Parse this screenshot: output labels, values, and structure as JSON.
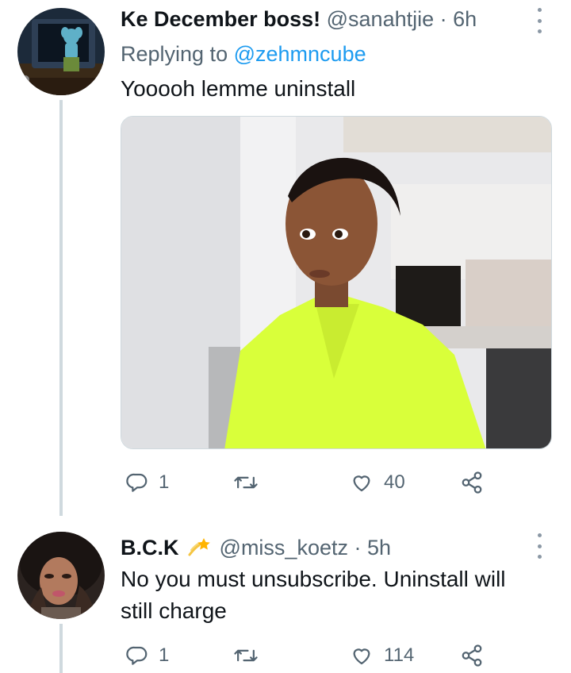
{
  "tweets": [
    {
      "display_name": "Ke December boss!",
      "handle": "@sanahtjie",
      "separator": "·",
      "time": "6h",
      "replying_prefix": "Replying to",
      "replying_to": "@zehmncube",
      "text": "Yooooh lemme uninstall",
      "has_media": true,
      "stats": {
        "replies": "1",
        "retweets": "",
        "likes": "40"
      }
    },
    {
      "display_name": "B.C.K",
      "name_emoji": "shooting-star-emoji",
      "handle": "@miss_koetz",
      "separator": "·",
      "time": "5h",
      "text": "No you must unsubscribe. Uninstall will still charge",
      "has_media": false,
      "stats": {
        "replies": "1",
        "retweets": "",
        "likes": "114"
      }
    }
  ],
  "icons": {
    "reply": "reply-icon",
    "retweet": "retweet-icon",
    "like": "heart-icon",
    "share": "share-icon",
    "more": "more-options-icon"
  },
  "colors": {
    "text": "#0f1419",
    "secondary": "#536471",
    "link": "#1d9bf0",
    "thread_line": "#cfd9de"
  }
}
